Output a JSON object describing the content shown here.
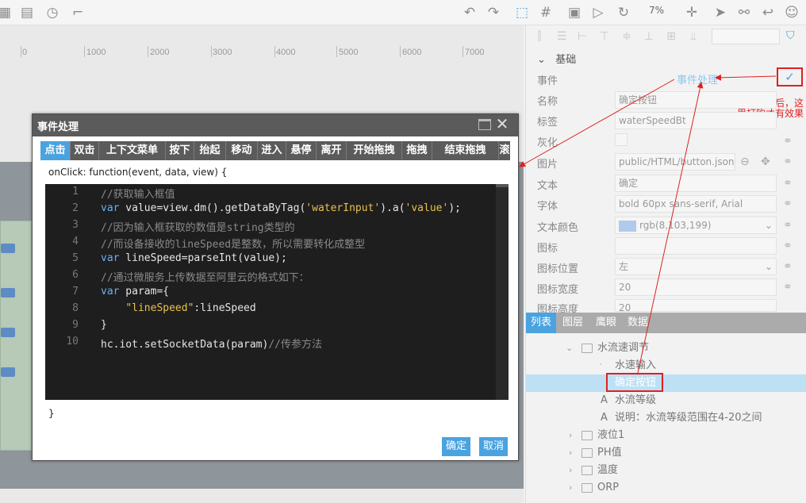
{
  "toolbar": {
    "zoom": "7%",
    "left_icons": [
      "grid-icon",
      "page-icon",
      "clock-icon",
      "hook-icon"
    ],
    "right_icons": [
      "undo-icon",
      "redo-icon",
      "select-icon",
      "grid-hash-icon",
      "save-icon",
      "play-icon",
      "refresh-icon",
      "crosshair-icon",
      "send-icon",
      "share-icon",
      "back-icon",
      "user-icon"
    ]
  },
  "ruler": {
    "labels": [
      "0",
      "1000",
      "2000",
      "3000",
      "4000",
      "5000",
      "6000",
      "7000"
    ]
  },
  "dialog": {
    "title": "事件处理",
    "tabs": [
      "点击",
      "双击",
      "上下文菜单",
      "按下",
      "抬起",
      "移动",
      "进入",
      "悬停",
      "离开",
      "开始拖拽",
      "拖拽",
      "结束拖拽",
      "滚"
    ],
    "signature": "onClick: function(event, data, view) {",
    "closing_brace": "}",
    "code_lines": [
      {
        "n": "1",
        "text": "//获取输入框值"
      },
      {
        "n": "2",
        "text": "var value=view.dm().getDataByTag('waterInput').a('value');"
      },
      {
        "n": "3",
        "text": "//因为输入框获取的数值是string类型的"
      },
      {
        "n": "4",
        "text": "//而设备接收的lineSpeed是整数，所以需要转化成整型"
      },
      {
        "n": "5",
        "text": "var lineSpeed=parseInt(value);"
      },
      {
        "n": "6",
        "text": "//通过微服务上传数据至阿里云的格式如下："
      },
      {
        "n": "7",
        "text": "var param={"
      },
      {
        "n": "8",
        "text": "    \"lineSpeed\":lineSpeed"
      },
      {
        "n": "9",
        "text": "}"
      },
      {
        "n": "10",
        "text": "hc.iot.setSocketData(param)//传参方法"
      }
    ],
    "confirm_label": "确定",
    "cancel_label": "取消"
  },
  "panel": {
    "section": "基础",
    "event_link": "事件处理",
    "check_mark": "✓",
    "annotation": "写好脚本后，这里打钩才有效果",
    "props": [
      {
        "label": "事件",
        "value": ""
      },
      {
        "label": "名称",
        "value": "确定按钮"
      },
      {
        "label": "标签",
        "value": "waterSpeedBt"
      },
      {
        "label": "灰化",
        "value": ""
      },
      {
        "label": "图片",
        "value": "public/HTML/button.json"
      },
      {
        "label": "文本",
        "value": "确定"
      },
      {
        "label": "字体",
        "value": "bold 60px sans-serif, Arial"
      },
      {
        "label": "文本颜色",
        "value": "rgb(8,103,199)"
      },
      {
        "label": "图标",
        "value": ""
      },
      {
        "label": "图标位置",
        "value": "左"
      },
      {
        "label": "图标宽度",
        "value": "20"
      },
      {
        "label": "图标高度",
        "value": "20"
      }
    ],
    "tree_tabs": [
      "列表",
      "图层",
      "鹰眼",
      "数据"
    ],
    "tree": [
      {
        "label": "水流速调节",
        "level": 1,
        "type": "folder",
        "expanded": true
      },
      {
        "label": "水速输入",
        "level": 2,
        "type": "node"
      },
      {
        "label": "确定按钮",
        "level": 2,
        "type": "node",
        "selected": true
      },
      {
        "label": "水流等级",
        "level": 2,
        "type": "text"
      },
      {
        "label": "说明：水流等级范围在4-20之间",
        "level": 2,
        "type": "text"
      },
      {
        "label": "液位1",
        "level": 1,
        "type": "folder"
      },
      {
        "label": "PH值",
        "level": 1,
        "type": "folder"
      },
      {
        "label": "温度",
        "level": 1,
        "type": "folder"
      },
      {
        "label": "ORP",
        "level": 1,
        "type": "folder"
      }
    ]
  },
  "colors": {
    "accent": "#4aa3df",
    "annotation_red": "#e02020",
    "dialog_header": "#5b5b5b",
    "code_bg": "#1e1e1e"
  }
}
